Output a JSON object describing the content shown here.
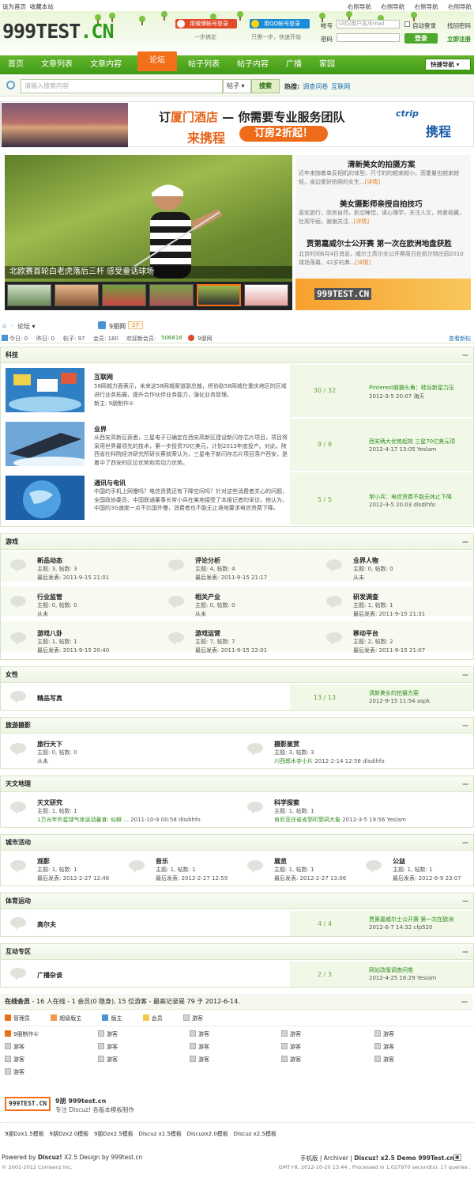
{
  "topbar": {
    "set_home": "设为首页",
    "bookmark": "收藏本站",
    "links": [
      "右侧导航",
      "右侧导航",
      "右侧导航",
      "右侧导航"
    ]
  },
  "logo": {
    "text": "999TEST",
    "cn": ".CN"
  },
  "login": {
    "weibo": "用微博帐号登录",
    "qq": "用QQ帐号登录",
    "weibo_sub": "一步搞定",
    "qq_sub": "只需一步，快速开始",
    "account_label": "帐号",
    "account_placeholder": "UID/用户名/Email",
    "password_label": "密码",
    "auto_login": "自动登录",
    "forgot": "找回密码",
    "submit": "登录",
    "register": "立即注册"
  },
  "nav": {
    "items": [
      "首页",
      "文章列表",
      "文章内容",
      "论坛",
      "帖子列表",
      "帖子内容",
      "广播",
      "家园"
    ],
    "quick": "快捷导航"
  },
  "search": {
    "placeholder": "请输入搜索内容",
    "type": "帖子",
    "button": "搜索",
    "hot_label": "热搜:",
    "hot": [
      "调查问卷",
      "互联网"
    ]
  },
  "banner": {
    "line1a": "订",
    "line1b": "厦门酒店",
    "line1c": " — 你需要专业服务团队",
    "line2": "来携程",
    "pill": "订房2折起！",
    "brand1": "ctrip",
    "brand2": "携程"
  },
  "slide": {
    "caption": "北欧赛首轮白老虎落后三杆  感受童话球场"
  },
  "rnews": [
    {
      "title": "清新美女的拍摄方案",
      "desc": "近年来随着单反相机的体型、尺寸的的越来越小，而重量也越来越轻，身边爱好拍照的女生...",
      "more": "[详情]"
    },
    {
      "title": "美女摄影师亲授自拍技巧",
      "desc": "喜欢旅行，崇尚自然，执空睡觉，读心理学，关注人文，热爱收藏，壮观华丽，谢谢关注...",
      "more": "[详情]"
    },
    {
      "title": "贾第嘉威尔士公开赛 第一次在欧洲地盘获胜",
      "desc": "北京时间6月4日消息，威尔士高尔夫公开赛周日在凯尔特庄园2010球场落幕，42岁的弗...",
      "more": "[详情]"
    }
  ],
  "rbanner": "999TEST.CN",
  "crumb": {
    "forum": "论坛",
    "site": "9朋网",
    "count": "27"
  },
  "stats": {
    "today": "今日: 0",
    "yesterday": "昨日: 0",
    "posts": "帖子: 97",
    "members": "会员: 180",
    "newest_label": "欢迎新会员:",
    "newest": "506816",
    "site": "9朋网",
    "view_new": "查看新帖"
  },
  "sections": {
    "tech": {
      "title": "科技",
      "forums": [
        {
          "name": "互联网",
          "desc": "58网城方面表示，未来这58网城渠道副总裁，将协助58网城在重庆地区的区域进行业务拓展，提升合作伙伴业务能力，强化业务管理。",
          "mod": "新主: 9朋制作①",
          "count": "30 / 32",
          "last1": "Pinterest崩霸头角：硅谷新星力压",
          "last2": "2012-3-5 20:07 海天"
        },
        {
          "name": "业界",
          "desc": "从西安高新区获悉，三星电子已确定在西安高新区建设新闪存芯片项目，项目将采用世界最领先的技术，第一步投资70亿美元，计划2013年底投产。对此，陕西省社科院经济研究所研长蔡就荣认为，三星电子新闪存芯片项目落户西安，是着中了西安的区位优势和劳动力优势。",
          "mod": "",
          "count": "9 / 9",
          "last1": "西安两大优势起效 三星70亿美元项",
          "last2": "2012-4-17 13:05 Yeslam"
        },
        {
          "name": "通讯与电讯",
          "desc": "中国的手机上网慢吗？电信资费还有下降空间吗？针对这些消费者关心的问题，全国政协委员、中国联通董事长常小兵在某地接受了本报记者的采访。他认为，中国的3G速度一点不比国外慢，消费者也不能无止境地要求电信资费下降。",
          "mod": "",
          "count": "5 / 5",
          "last1": "常小兵：电信资费不能无休止下降",
          "last2": "2012-3-5 20:03 dlsdihfo"
        }
      ]
    },
    "game": {
      "title": "游戏",
      "cells": [
        {
          "name": "新品动态",
          "stat": "主题: 3, 帖数: 3",
          "last": "最后发表: 2011-9-15 21:01"
        },
        {
          "name": "评论分析",
          "stat": "主题: 4, 帖数: 4",
          "last": "最后发表: 2011-9-15 21:17"
        },
        {
          "name": "业界人物",
          "stat": "主题: 0, 帖数: 0",
          "last": "从未"
        },
        {
          "name": "行业监管",
          "stat": "主题: 0, 帖数: 0",
          "last": "从未"
        },
        {
          "name": "相关产业",
          "stat": "主题: 0, 帖数: 0",
          "last": "从未"
        },
        {
          "name": "研发调查",
          "stat": "主题: 1, 帖数: 1",
          "last": "最后发表: 2011-9-15 21:31"
        },
        {
          "name": "游戏八卦",
          "stat": "主题: 1, 帖数: 1",
          "last": "最后发表: 2011-9-15 20:40"
        },
        {
          "name": "游戏运营",
          "stat": "主题: 7, 帖数: 7",
          "last": "最后发表: 2011-9-15 22:01"
        },
        {
          "name": "移动平台",
          "stat": "主题: 2, 帖数: 2",
          "last": "最后发表: 2011-9-15 21:07"
        }
      ]
    },
    "women": {
      "title": "女性",
      "name": "精品写真",
      "count": "13 / 13",
      "last1": "清新美女的拍摄方案",
      "last2": "2012-9-15 11:54 aspk"
    },
    "travel": {
      "title": "旅游摄影",
      "cells": [
        {
          "name": "旅行天下",
          "stat": "主题: 0, 帖数: 0",
          "last": "从未"
        },
        {
          "name": "摄影鉴赏",
          "stat": "主题: 3, 帖数: 3",
          "last_g": "川西郎木寺小片",
          "last": " 2012-2-14 12:56 dlsdihfo"
        }
      ]
    },
    "astro": {
      "title": "天文地理",
      "cells": [
        {
          "name": "天文研究",
          "stat": "主题: 1, 帖数: 1",
          "last_g": "1万光年外星球气体运动暴食: 似鲜 ...",
          "last": " 2011-10-9 00:58 dlsdihfo"
        },
        {
          "name": "科学探索",
          "stat": "主题: 1, 帖数: 1",
          "last_g": "肯尼亚往省省郭叩郭洞大象",
          "last": " 2012-3-5 19:56 Yeslam"
        }
      ]
    },
    "city": {
      "title": "城市活动",
      "cells": [
        {
          "name": "观影",
          "stat": "主题: 1, 帖数: 1",
          "last": "最后发表: 2012-2-27 12:46"
        },
        {
          "name": "音乐",
          "stat": "主题: 1, 帖数: 1",
          "last": "最后发表: 2012-2-27 12:59"
        },
        {
          "name": "展览",
          "stat": "主题: 1, 帖数: 1",
          "last": "最后发表: 2012-2-27 13:06"
        },
        {
          "name": "公益",
          "stat": "主题: 1, 帖数: 1",
          "last": "最后发表: 2012-6-9 23:07"
        }
      ]
    },
    "sport": {
      "title": "体育运动",
      "name": "高尔夫",
      "count": "4 / 4",
      "last1": "贾第嘉威尔士公开赛 第一次在欧洲",
      "last2": "2012-6-7 14:32 cfp520"
    },
    "interact": {
      "title": "互动专区",
      "name": "广播杂谈",
      "count": "2 / 3",
      "last1": "网站改版调查问卷",
      "last2": "2012-4-25 16:29 Yeslam"
    }
  },
  "online": {
    "title": "在线会员",
    "summary": " - 16 人在线 - 1 会员(0 隐身), 15 位游客 - 最高记录是 79 于 2012-6-14.",
    "legend": [
      "管理员",
      "超级版主",
      "版主",
      "会员",
      "游客"
    ],
    "first": "9朋制作①",
    "guest": "游客"
  },
  "footer": {
    "logo": "999TEST.CN",
    "site": "9朋 999test.cn",
    "slogan": "专注 Discuz! 各版本模板制作",
    "links": [
      "9朋Dzx1.5模板",
      "9朋Dzx2.0模板",
      "9朋Dzx2.5模板",
      "Discuz x1.5模板",
      "Discuzx2.0模板",
      "Discuz x2.5模板"
    ],
    "powered": "Powered by ",
    "discuz": "Discuz!",
    "ver": " X2.5 Design by 999test.cn",
    "right_links": "手机版 | Archiver | ",
    "right_bold": "Discuz! x2.5 Demo 999Test.cn",
    "copyright": "© 2001-2012 Comsenz Inc.",
    "gmt": "GMT+8, 2012-10-20 13:44 , Processed in 1.027970 second(s), 17 queries ."
  },
  "colors": {
    "nav_green": "#4ea82b",
    "nav_active": "#f36f1a",
    "link_green": "#2d8a1a"
  }
}
